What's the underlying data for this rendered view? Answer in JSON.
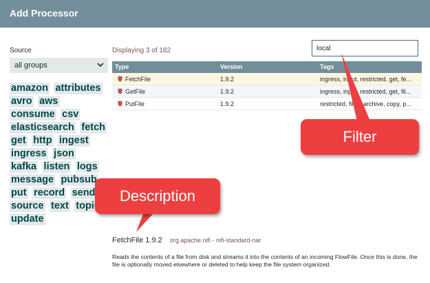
{
  "dialog": {
    "title": "Add Processor"
  },
  "source": {
    "label": "Source",
    "selected": "all groups"
  },
  "tags": [
    "amazon",
    "attributes",
    "avro",
    "aws",
    "consume",
    "csv",
    "elasticsearch",
    "fetch",
    "get",
    "http",
    "ingest",
    "ingress",
    "json",
    "kafka",
    "listen",
    "logs",
    "message",
    "pubsub",
    "put",
    "record",
    "send",
    "source",
    "text",
    "topic",
    "update"
  ],
  "status": {
    "displaying": "Displaying 3 of 182"
  },
  "filter": {
    "value": "local"
  },
  "table": {
    "columns": [
      "Type",
      "Version",
      "Tags"
    ],
    "rows": [
      {
        "type": "FetchFile",
        "version": "1.9.2",
        "tags": "ingress, input, restricted, get, fe..."
      },
      {
        "type": "GetFile",
        "version": "1.9.2",
        "tags": "ingress, input, restricted, get, fil..."
      },
      {
        "type": "PutFile",
        "version": "1.9.2",
        "tags": "restricted, files, archive, copy, p..."
      }
    ]
  },
  "description": {
    "name": "FetchFile 1.9.2",
    "bundle": "org.apache.nifi - nifi-standard-nar",
    "text": "Reads the contents of a file from disk and streams it into the contents of an incoming FlowFile. Once this is done, the file is optionally moved elsewhere or deleted to help keep the file system organized."
  },
  "callouts": {
    "filter": "Filter",
    "description": "Description"
  },
  "colors": {
    "header": "#728e9b",
    "tag_text": "#004849",
    "callout": "#ed3f3f",
    "selected_row": "#fff6e1"
  },
  "icons": {
    "select": "chevron-down-icon",
    "restricted": "shield-icon"
  }
}
